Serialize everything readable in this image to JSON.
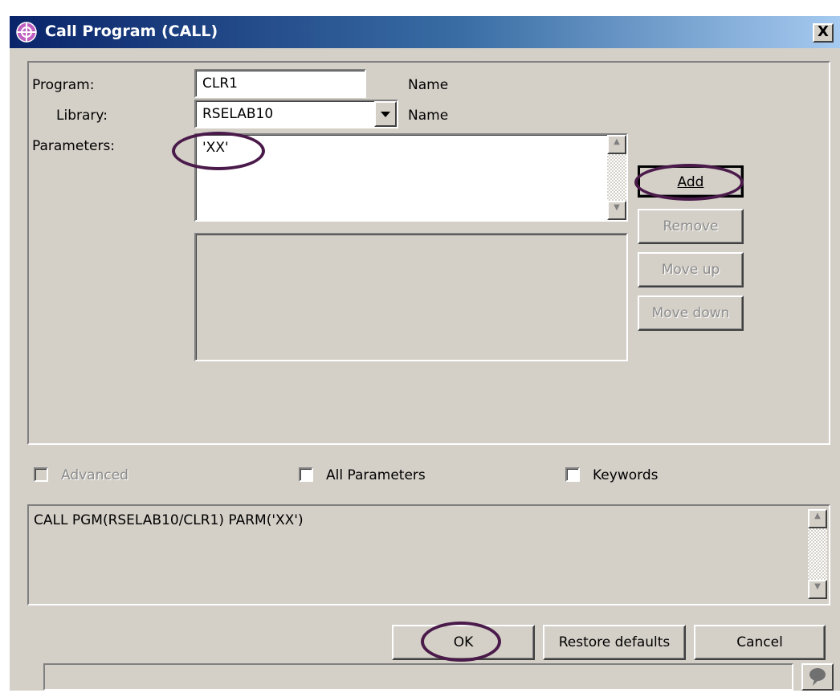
{
  "window": {
    "title": "Call Program (CALL)",
    "close_label": "X"
  },
  "form": {
    "program_label": "Program:",
    "program_value": "CLR1",
    "program_hint": "Name",
    "library_label": "Library:",
    "library_value": "RSELAB10",
    "library_hint": "Name",
    "parameters_label": "Parameters:",
    "parameter_input_value": "'XX'"
  },
  "param_buttons": {
    "add": "Add",
    "remove": "Remove",
    "move_up": "Move up",
    "move_down": "Move down"
  },
  "options": {
    "advanced": "Advanced",
    "all_parameters": "All Parameters",
    "keywords": "Keywords"
  },
  "command_preview": "CALL PGM(RSELAB10/CLR1) PARM('XX')",
  "footer": {
    "ok": "OK",
    "restore_defaults": "Restore defaults",
    "cancel": "Cancel"
  },
  "icons": {
    "app": "crosshair-logo-icon",
    "dropdown": "chevron-down-icon",
    "help": "speech-bubble-icon"
  },
  "colors": {
    "titlebar_start": "#0a246a",
    "titlebar_end": "#a6caf0",
    "highlight_ellipse": "#4a1a4a",
    "dialog_bg": "#d4d0c8"
  }
}
